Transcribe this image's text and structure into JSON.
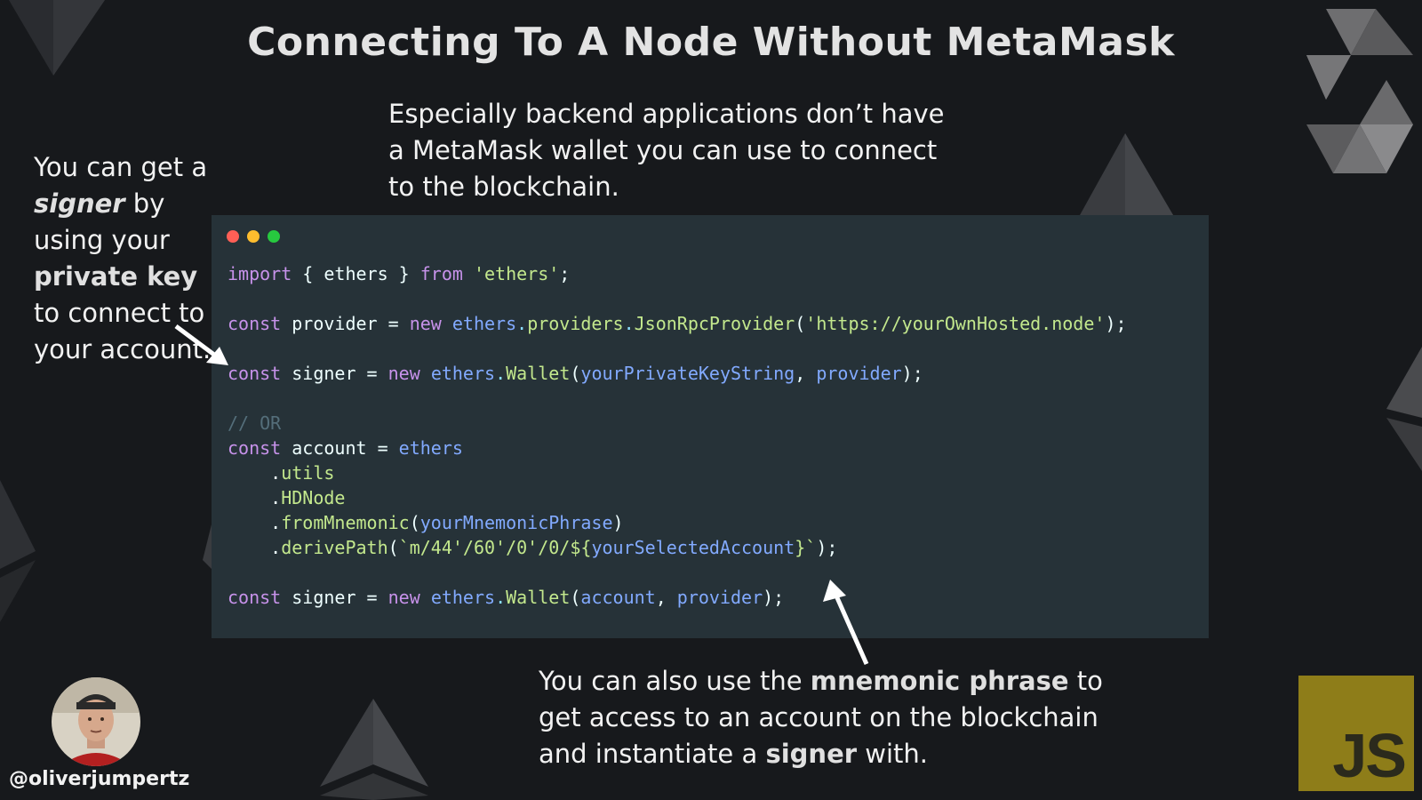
{
  "title": "Connecting To A Node Without MetaMask",
  "intro": "Especially backend applications don’t have a MetaMask wallet you can use to connect to the blockchain.",
  "left_note": {
    "part1": "You can get a ",
    "signer": "signer",
    "part2": " by using your ",
    "private_key": "private key",
    "part3": " to connect to your account."
  },
  "bottom_note": {
    "part1": "You can also use the ",
    "mnemonic": "mnemonic phrase",
    "part2": " to get access to an account on the blockchain and instantiate a ",
    "signer": "signer",
    "part3": " with."
  },
  "window_dots": [
    "#ff5f56",
    "#ffbd2e",
    "#27c93f"
  ],
  "code": {
    "l1": {
      "kw1": "import",
      "t1": " { ethers } ",
      "kw2": "from",
      "sp": " ",
      "str": "'ethers'",
      "end": ";"
    },
    "l2": {
      "kw": "const",
      "t1": " provider = ",
      "kw2": "new",
      "sp": " ",
      "var": "ethers",
      "dot1": ".",
      "m1": "providers",
      "dot2": ".",
      "m2": "JsonRpcProvider",
      "p1": "(",
      "str": "'https://yourOwnHosted.node'",
      "end": ");"
    },
    "l3": {
      "kw": "const",
      "t1": " signer = ",
      "kw2": "new",
      "sp": " ",
      "var": "ethers",
      "dot": ".",
      "m": "Wallet",
      "p1": "(",
      "a1": "yourPrivateKeyString",
      "c": ", ",
      "a2": "provider",
      "end": ");"
    },
    "l4": "// OR",
    "l5": {
      "kw": "const",
      "t1": " account = ",
      "var": "ethers"
    },
    "l6": {
      "indent": "    .",
      "m": "utils"
    },
    "l7": {
      "indent": "    .",
      "m": "HDNode"
    },
    "l8": {
      "indent": "    .",
      "m": "fromMnemonic",
      "p1": "(",
      "a": "yourMnemonicPhrase",
      "end": ")"
    },
    "l9": {
      "indent": "    .",
      "m": "derivePath",
      "p1": "(",
      "str1": "`m/44'/60'/0'/0/${",
      "a": "yourSelectedAccount",
      "str2": "}`",
      "end": ");"
    },
    "l10": {
      "kw": "const",
      "t1": " signer = ",
      "kw2": "new",
      "sp": " ",
      "var": "ethers",
      "dot": ".",
      "m": "Wallet",
      "p1": "(",
      "a1": "account",
      "c": ", ",
      "a2": "provider",
      "end": ");"
    }
  },
  "author": {
    "handle": "@oliverjumpertz"
  },
  "badge": {
    "label": "JS"
  }
}
